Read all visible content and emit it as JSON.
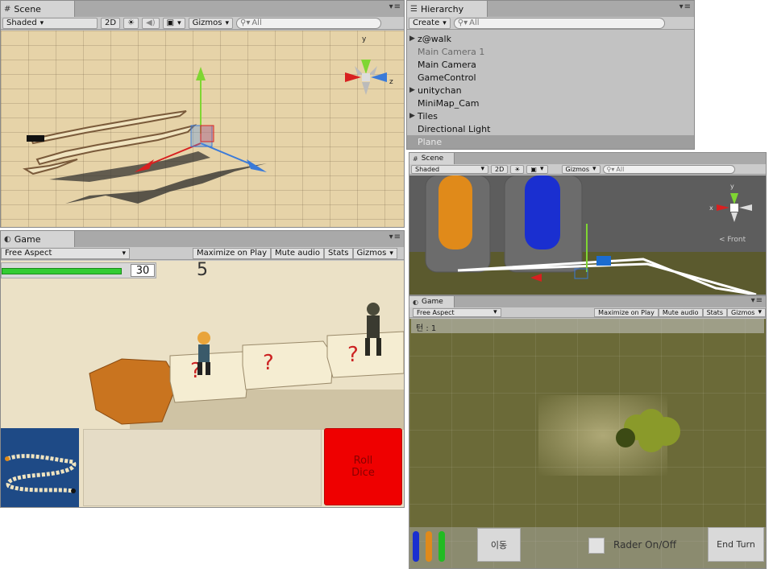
{
  "scene_top": {
    "tab": "Scene",
    "shading": "Shaded",
    "mode_2d": "2D",
    "gizmos": "Gizmos",
    "search_placeholder": "All",
    "gizmo_axes": {
      "y": "y",
      "z": "z"
    }
  },
  "hierarchy": {
    "tab": "Hierarchy",
    "create": "Create",
    "search_placeholder": "All",
    "items": [
      {
        "label": "z@walk",
        "expandable": true,
        "dim": false
      },
      {
        "label": "Main Camera 1",
        "expandable": false,
        "dim": true
      },
      {
        "label": "Main Camera",
        "expandable": false,
        "dim": false
      },
      {
        "label": "GameControl",
        "expandable": false,
        "dim": false
      },
      {
        "label": "unitychan",
        "expandable": true,
        "dim": false
      },
      {
        "label": "MiniMap_Cam",
        "expandable": false,
        "dim": false
      },
      {
        "label": "Tiles",
        "expandable": true,
        "dim": false
      },
      {
        "label": "Directional Light",
        "expandable": false,
        "dim": false
      },
      {
        "label": "Plane",
        "expandable": false,
        "dim": true
      }
    ]
  },
  "game_left": {
    "tab": "Game",
    "aspect": "Free Aspect",
    "maximize": "Maximize on Play",
    "mute": "Mute audio",
    "stats": "Stats",
    "gizmos": "Gizmos",
    "hp_value": "30",
    "hp_fraction": 0.95,
    "dice_number": "5",
    "roll_label_1": "Roll",
    "roll_label_2": "Dice"
  },
  "scene_right": {
    "tab": "Scene",
    "shading": "Shaded",
    "mode_2d": "2D",
    "gizmos": "Gizmos",
    "search_placeholder": "All",
    "gizmo_x": "x",
    "gizmo_y": "y",
    "gizmo_label": "< Front"
  },
  "game_right": {
    "tab": "Game",
    "aspect": "Free Aspect",
    "maximize": "Maximize on Play",
    "mute": "Mute audio",
    "stats": "Stats",
    "gizmos": "Gizmos",
    "turn_label": "턴 : 1",
    "move_button": "이동",
    "radar_label": "Rader On/Off",
    "end_turn": "End Turn"
  },
  "colors": {
    "accent_red": "#ef0000",
    "hp_green": "#33cc33",
    "minimap_blue": "#1e4a86",
    "orange_bar": "#e08a1a",
    "blue_bar": "#1a2fd0"
  }
}
